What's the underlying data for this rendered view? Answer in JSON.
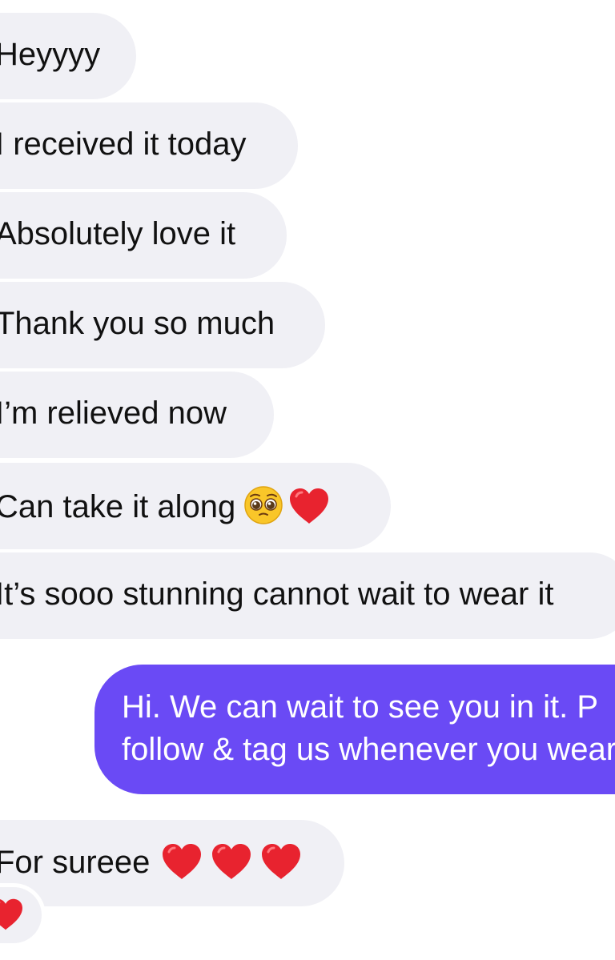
{
  "messages": [
    {
      "direction": "incoming",
      "text": "Heyyyy"
    },
    {
      "direction": "incoming",
      "text": "I received it today"
    },
    {
      "direction": "incoming",
      "text": "Absolutely love it"
    },
    {
      "direction": "incoming",
      "text": "Thank you so much"
    },
    {
      "direction": "incoming",
      "text": "I’m relieved now"
    },
    {
      "direction": "incoming",
      "text": "Can take it along",
      "emojis": [
        "pleading-face",
        "red-heart"
      ]
    },
    {
      "direction": "incoming",
      "text": "It’s sooo stunning cannot wait to wear it"
    },
    {
      "direction": "outgoing",
      "lines": [
        "Hi. We can wait to see you in it. P",
        "follow & tag us whenever you wear it"
      ]
    },
    {
      "direction": "incoming",
      "text": "For sureee",
      "emojis": [
        "red-heart",
        "red-heart",
        "red-heart"
      ]
    }
  ],
  "reaction": {
    "emoji": "red-heart"
  },
  "colors": {
    "incoming_bubble": "#f0f0f5",
    "outgoing_bubble": "#6a4af5",
    "incoming_text": "#111111",
    "outgoing_text": "#ffffff",
    "heart": "#e8232f"
  }
}
